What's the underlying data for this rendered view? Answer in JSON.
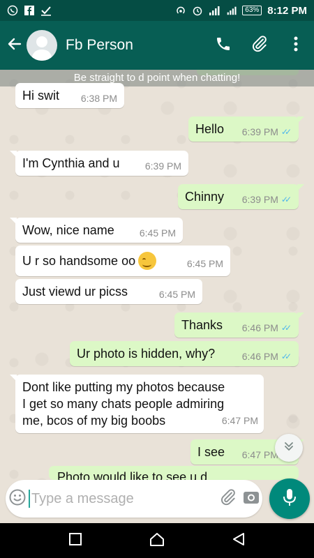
{
  "status_bar": {
    "time": "8:12 PM",
    "battery": "63%",
    "network": "3G"
  },
  "header": {
    "contact_name": "Fb Person"
  },
  "banner": "Be straight to d point when chatting!",
  "messages": [
    {
      "dir": "in",
      "text": "Hi swit",
      "time": "6:38 PM"
    },
    {
      "dir": "out",
      "text": "Hello",
      "time": "6:39 PM"
    },
    {
      "dir": "in",
      "text": "I'm Cynthia and u",
      "time": "6:39 PM"
    },
    {
      "dir": "out",
      "text": "Chinny",
      "time": "6:39 PM"
    },
    {
      "dir": "in",
      "text": "Wow, nice name",
      "time": "6:45 PM"
    },
    {
      "dir": "in",
      "text": "U r so handsome oo",
      "time": "6:45 PM",
      "emoji": "smirking-face"
    },
    {
      "dir": "in",
      "text": "Just viewd ur picss",
      "time": "6:45 PM"
    },
    {
      "dir": "out",
      "text": "Thanks",
      "time": "6:46 PM"
    },
    {
      "dir": "out",
      "text": "Ur photo is hidden, why?",
      "time": "6:46 PM"
    },
    {
      "dir": "in",
      "lines": [
        "Dont like putting my photos because",
        "I get so many chats people admiring",
        "me, bcos of my big boobs"
      ],
      "time": "6:47 PM"
    },
    {
      "dir": "out",
      "text": "I see",
      "time": "6:47 PM"
    }
  ],
  "partial_message_text": "Photo would like to see u,d…",
  "composer": {
    "placeholder": "Type a message"
  },
  "colors": {
    "header": "#075e54",
    "status_bar": "#054d44",
    "outgoing_bubble": "#dcf8c6",
    "incoming_bubble": "#ffffff",
    "read_ticks": "#4fb6ec",
    "mic_button": "#00897b"
  },
  "icons": {
    "status_left": [
      "whatsapp-icon",
      "facebook-icon",
      "checkbox-icon"
    ],
    "status_right": [
      "hotspot-icon",
      "alarm-icon",
      "signal-icon",
      "signal-3g-icon",
      "battery-icon"
    ],
    "header": [
      "back-arrow-icon",
      "phone-icon",
      "attachment-icon",
      "more-vert-icon"
    ],
    "composer": [
      "emoji-icon",
      "attachment-icon",
      "camera-icon",
      "mic-icon"
    ],
    "nav": [
      "recents-square-icon",
      "home-icon",
      "back-triangle-icon"
    ]
  }
}
